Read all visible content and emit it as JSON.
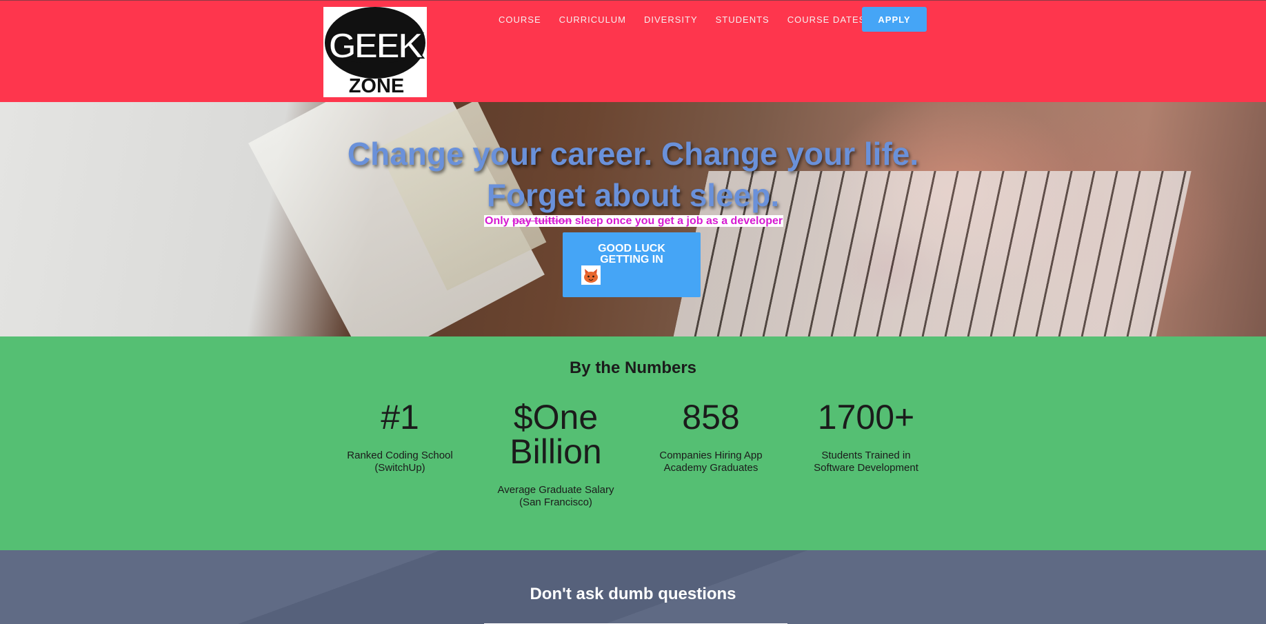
{
  "header": {
    "logo_text_top": "GEEK",
    "logo_text_bottom": "ZONE",
    "nav": [
      "COURSE",
      "CURRICULUM",
      "DIVERSITY",
      "STUDENTS",
      "COURSE DATES"
    ],
    "apply_label": "APPLY",
    "background_color": "#fe364d",
    "accent_color": "#45a5f6"
  },
  "hero": {
    "title_line1": "Change your career. Change your life.",
    "title_line2": "Forget about sleep.",
    "sub_prefix": "Only",
    "sub_strike": "pay tuittion",
    "sub_suffix": "sleep once you get a job as a developer",
    "button_line1": "GOOD LUCK",
    "button_line2": "GETTING IN",
    "button_icon": "cat-emoji-icon",
    "title_color": "#6a91da",
    "sub_color": "#d61ad2"
  },
  "numbers": {
    "heading": "By the Numbers",
    "background_color": "#55bf73",
    "stats": [
      {
        "value": "#1",
        "desc_line1": "Ranked Coding School",
        "desc_line2": "(SwitchUp)"
      },
      {
        "value_line1": "$One",
        "value_line2": "Billion",
        "desc_line1": "Average Graduate Salary",
        "desc_line2": "(San Francisco)"
      },
      {
        "value": "858",
        "desc_line1": "Companies Hiring App",
        "desc_line2": "Academy Graduates"
      },
      {
        "value": "1700+",
        "desc_line1": "Students Trained in",
        "desc_line2": "Software Development"
      }
    ]
  },
  "bottom": {
    "heading": "Don't ask dumb questions",
    "background_color": "#5a6580"
  }
}
